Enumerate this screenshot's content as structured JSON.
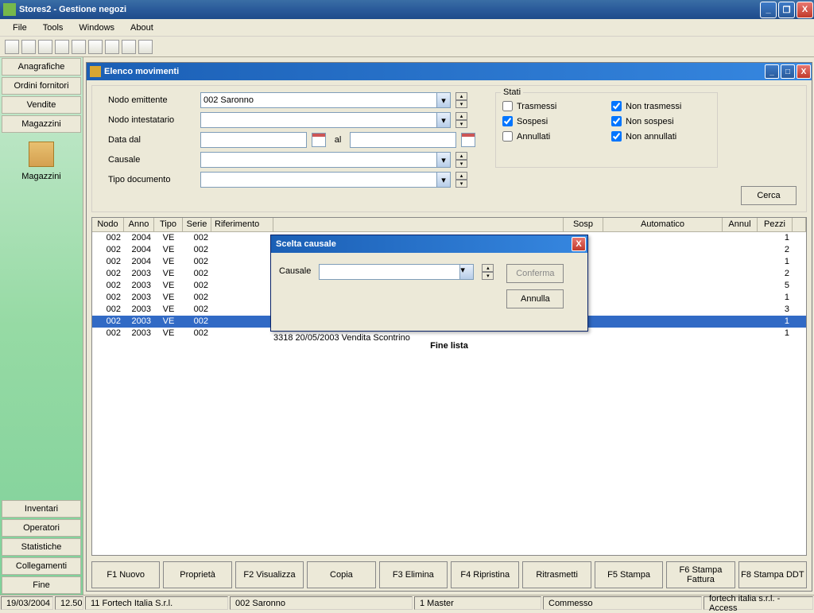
{
  "app_title": "Stores2 - Gestione negozi",
  "menubar": [
    "File",
    "Tools",
    "Windows",
    "About"
  ],
  "sidebar": {
    "buttons": [
      "Anagrafiche",
      "Ordini fornitori",
      "Vendite",
      "Magazzini"
    ],
    "selected_label": "Magazzini",
    "bottom": [
      "Inventari",
      "Operatori",
      "Statistiche",
      "Collegamenti",
      "Fine"
    ]
  },
  "child": {
    "title": "Elenco movimenti",
    "filters": {
      "nodo_emittente_label": "Nodo emittente",
      "nodo_emittente_value": "002 Saronno",
      "nodo_intestatario_label": "Nodo intestatario",
      "data_dal_label": "Data dal",
      "al_label": "al",
      "causale_label": "Causale",
      "tipo_doc_label": "Tipo documento"
    },
    "stati": {
      "legend": "Stati",
      "trasmessi": "Trasmessi",
      "trasmessi_checked": false,
      "non_trasmessi": "Non trasmessi",
      "non_trasmessi_checked": true,
      "sospesi": "Sospesi",
      "sospesi_checked": true,
      "non_sospesi": "Non sospesi",
      "non_sospesi_checked": true,
      "annullati": "Annullati",
      "annullati_checked": false,
      "non_annullati": "Non annullati",
      "non_annullati_checked": true
    },
    "cerca": "Cerca",
    "columns": [
      "Nodo",
      "Anno",
      "Tipo",
      "Serie",
      "Riferimento",
      "",
      "Sosp",
      "Automatico",
      "Annul",
      "Pezzi"
    ],
    "rows": [
      {
        "nodo": "002",
        "anno": "2004",
        "tipo": "VE",
        "serie": "002",
        "pezzi": "1"
      },
      {
        "nodo": "002",
        "anno": "2004",
        "tipo": "VE",
        "serie": "002",
        "pezzi": "2"
      },
      {
        "nodo": "002",
        "anno": "2004",
        "tipo": "VE",
        "serie": "002",
        "pezzi": "1"
      },
      {
        "nodo": "002",
        "anno": "2003",
        "tipo": "VE",
        "serie": "002",
        "pezzi": "2"
      },
      {
        "nodo": "002",
        "anno": "2003",
        "tipo": "VE",
        "serie": "002",
        "pezzi": "5"
      },
      {
        "nodo": "002",
        "anno": "2003",
        "tipo": "VE",
        "serie": "002",
        "pezzi": "1"
      },
      {
        "nodo": "002",
        "anno": "2003",
        "tipo": "VE",
        "serie": "002",
        "pezzi": "3"
      },
      {
        "nodo": "002",
        "anno": "2003",
        "tipo": "VE",
        "serie": "002",
        "pezzi": "1",
        "selected": true
      },
      {
        "nodo": "002",
        "anno": "2003",
        "tipo": "VE",
        "serie": "002",
        "pezzi": "1"
      }
    ],
    "partial_row_text": "3318 20/05/2003 Vendita Scontrino",
    "fine_lista": "Fine lista",
    "buttons": [
      "F1 Nuovo",
      "Proprietà",
      "F2 Visualizza",
      "Copia",
      "F3 Elimina",
      "F4 Ripristina",
      "Ritrasmetti",
      "F5 Stampa",
      "F6 Stampa Fattura",
      "F8 Stampa DDT"
    ]
  },
  "modal": {
    "title": "Scelta causale",
    "causale_label": "Causale",
    "conferma": "Conferma",
    "annulla": "Annulla"
  },
  "status": {
    "date": "19/03/2004",
    "time": "12.50",
    "company": "11 Fortech Italia S.r.l.",
    "node": "002 Saronno",
    "master": "1 Master",
    "commesso": "Commesso",
    "credits": "fortech italia s.r.l. - Access"
  }
}
